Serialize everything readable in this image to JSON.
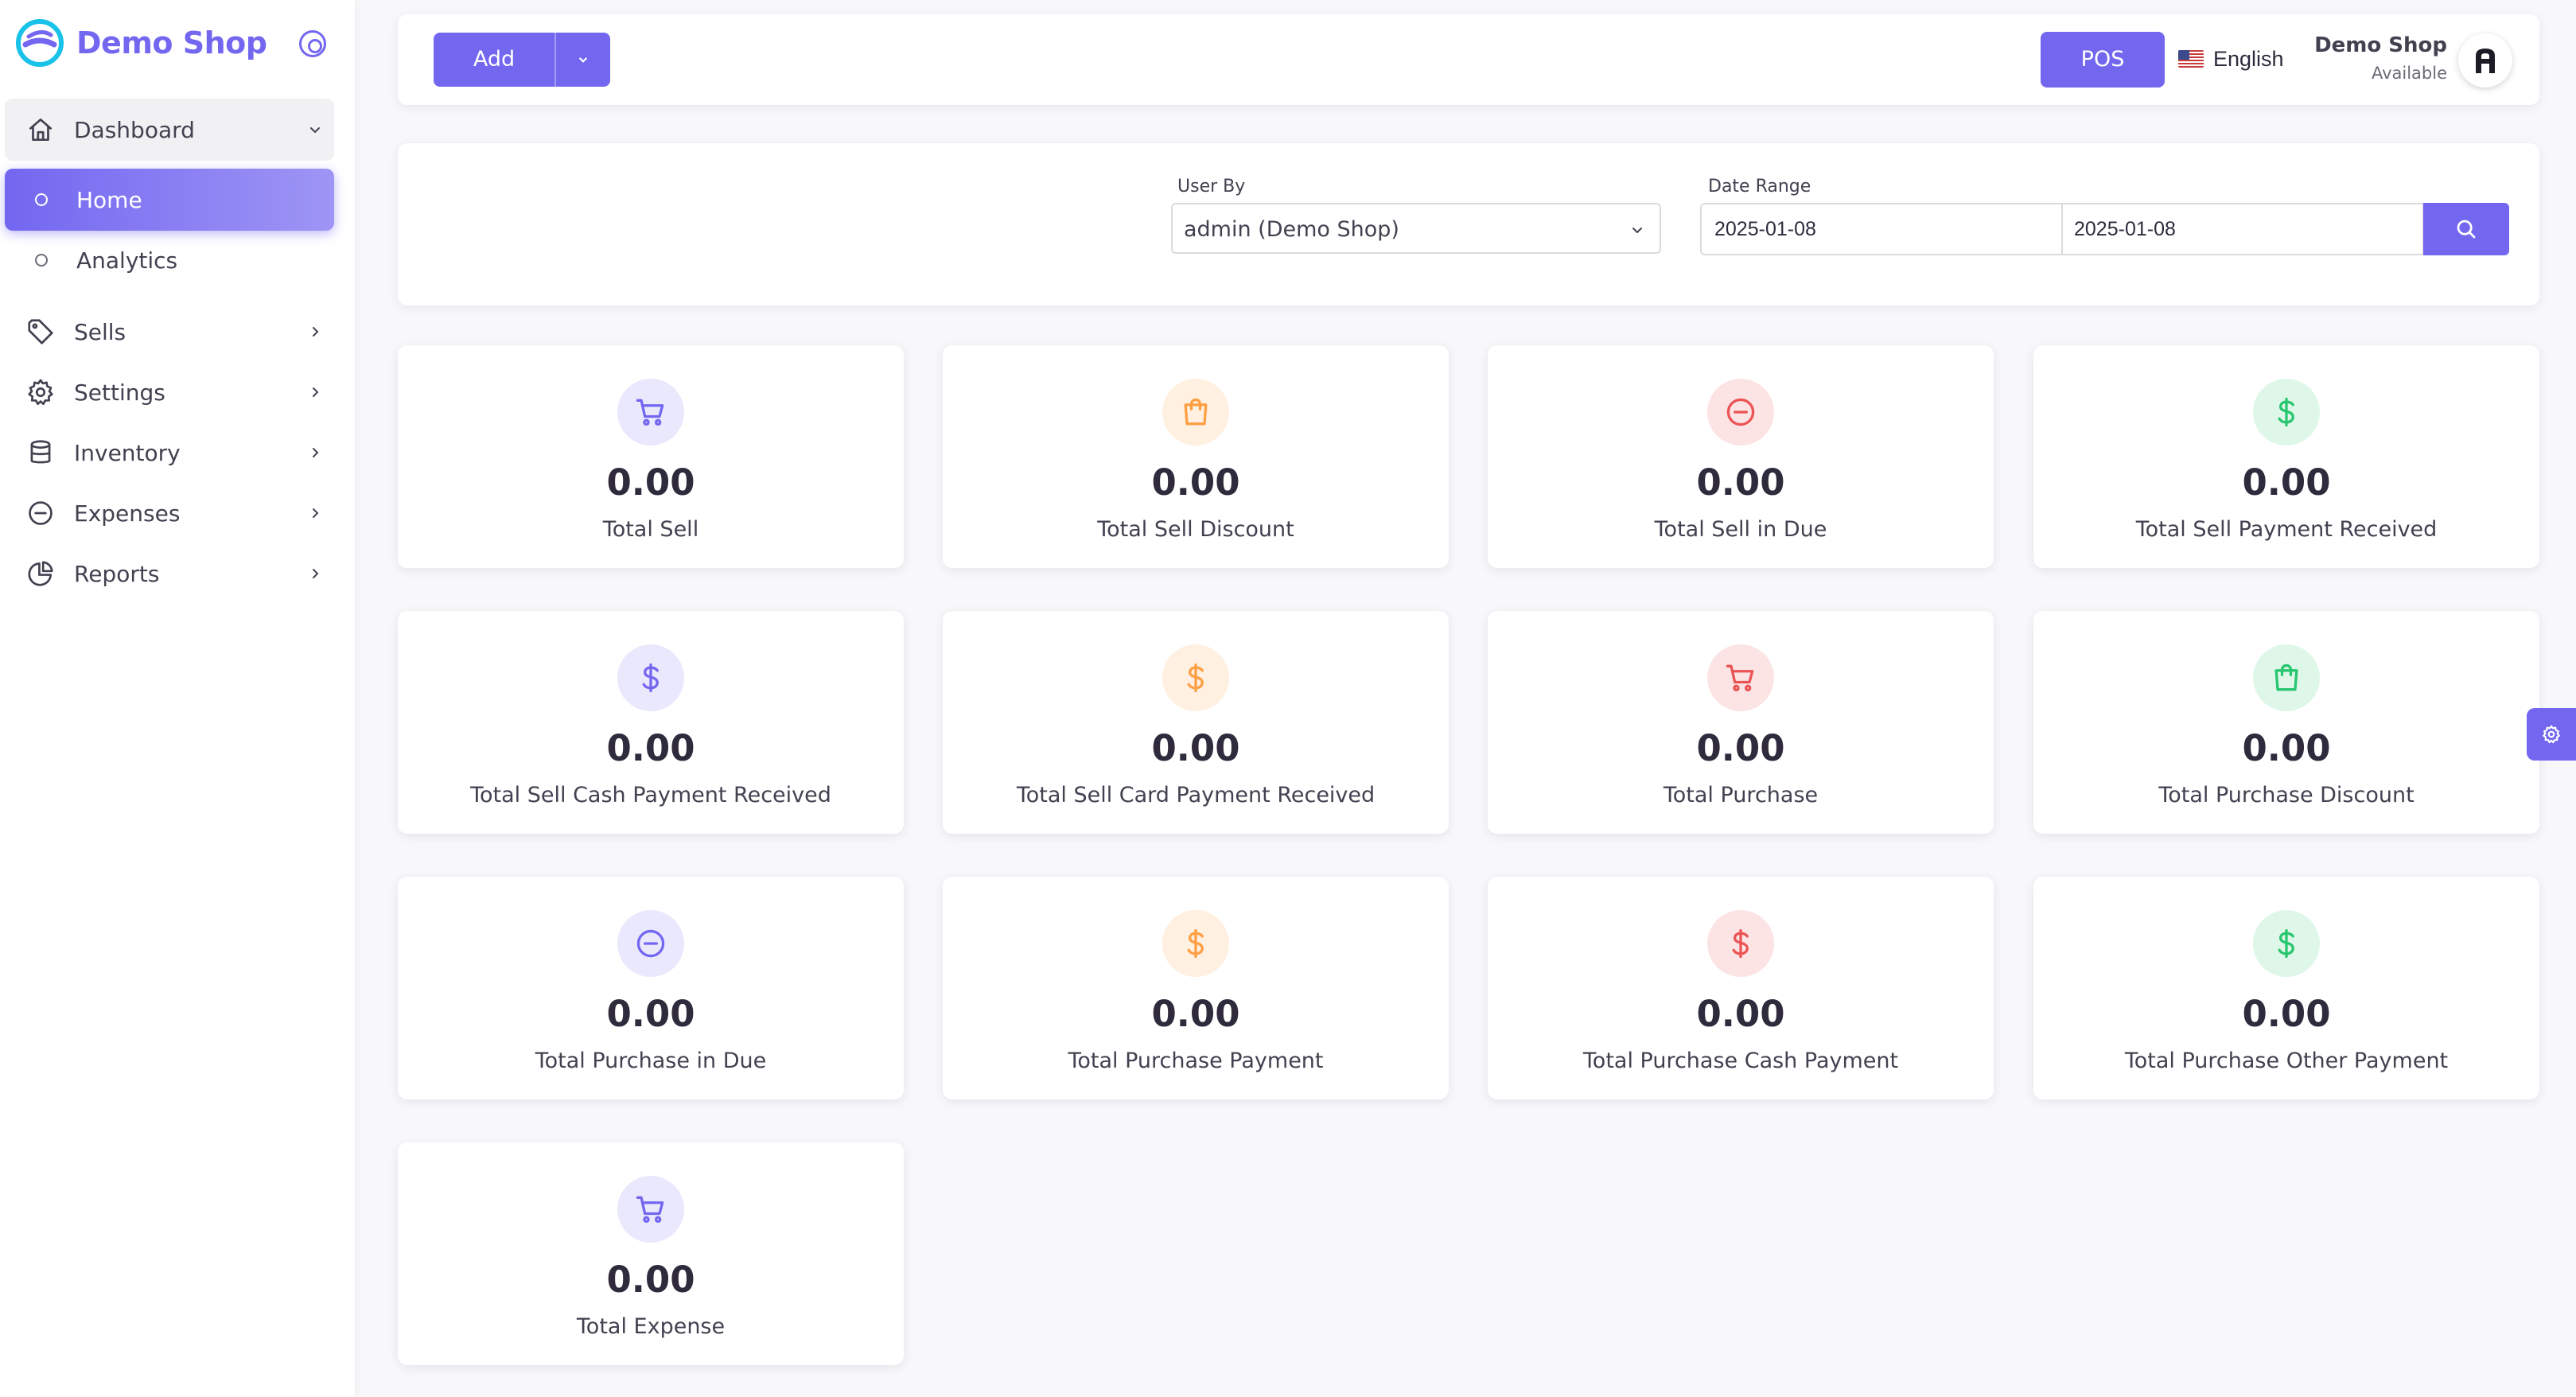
{
  "brand": {
    "name": "Demo Shop",
    "logo_icon": "brand-logo-icon",
    "toggle_icon": "radio-circle-icon"
  },
  "sidebar": {
    "dashboard": {
      "label": "Dashboard",
      "icon": "home-icon"
    },
    "sub_items": [
      {
        "label": "Home",
        "active": true
      },
      {
        "label": "Analytics",
        "active": false
      }
    ],
    "items": [
      {
        "label": "Sells",
        "icon": "tag-icon"
      },
      {
        "label": "Settings",
        "icon": "gear-icon"
      },
      {
        "label": "Inventory",
        "icon": "database-icon"
      },
      {
        "label": "Expenses",
        "icon": "minus-circle-icon"
      },
      {
        "label": "Reports",
        "icon": "pie-chart-icon"
      }
    ]
  },
  "navbar": {
    "add_label": "Add",
    "pos_label": "POS",
    "language": "English",
    "user_name": "Demo Shop",
    "user_status": "Available"
  },
  "filters": {
    "user_by_label": "User By",
    "user_by_value": "admin (Demo Shop)",
    "date_range_label": "Date Range",
    "date_from": "2025-01-08",
    "date_to": "2025-01-08"
  },
  "stats": [
    {
      "value": "0.00",
      "label": "Total Sell",
      "icon": "cart-icon",
      "color": "purple"
    },
    {
      "value": "0.00",
      "label": "Total Sell Discount",
      "icon": "shopping-bag-icon",
      "color": "orange"
    },
    {
      "value": "0.00",
      "label": "Total Sell in Due",
      "icon": "minus-circle-icon",
      "color": "red"
    },
    {
      "value": "0.00",
      "label": "Total Sell Payment Received",
      "icon": "dollar-icon",
      "color": "green"
    },
    {
      "value": "0.00",
      "label": "Total Sell Cash Payment Received",
      "icon": "dollar-icon",
      "color": "purple"
    },
    {
      "value": "0.00",
      "label": "Total Sell Card Payment Received",
      "icon": "dollar-icon",
      "color": "orange"
    },
    {
      "value": "0.00",
      "label": "Total Purchase",
      "icon": "cart-icon",
      "color": "red"
    },
    {
      "value": "0.00",
      "label": "Total Purchase Discount",
      "icon": "shopping-bag-icon",
      "color": "green"
    },
    {
      "value": "0.00",
      "label": "Total Purchase in Due",
      "icon": "minus-circle-icon",
      "color": "purple"
    },
    {
      "value": "0.00",
      "label": "Total Purchase Payment",
      "icon": "dollar-icon",
      "color": "orange"
    },
    {
      "value": "0.00",
      "label": "Total Purchase Cash Payment",
      "icon": "dollar-icon",
      "color": "red"
    },
    {
      "value": "0.00",
      "label": "Total Purchase Other Payment",
      "icon": "dollar-icon",
      "color": "green"
    },
    {
      "value": "0.00",
      "label": "Total Expense",
      "icon": "cart-icon",
      "color": "purple"
    }
  ],
  "colors": {
    "accent": "#7367f0",
    "purple": "#7367f0",
    "orange": "#ff9f43",
    "red": "#ea5455",
    "green": "#28c76f"
  }
}
